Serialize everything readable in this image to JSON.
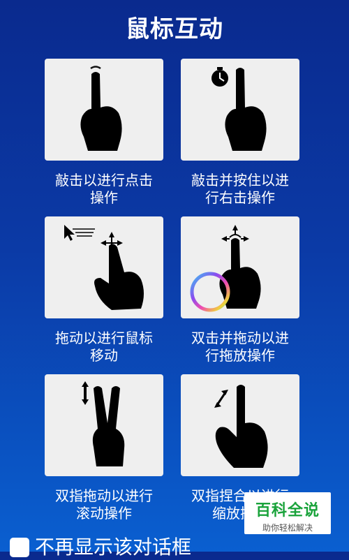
{
  "title": "鼠标互动",
  "gestures": [
    {
      "caption_line1": "敲击以进行点击",
      "caption_line2": "操作",
      "icon": "tap-hand-icon"
    },
    {
      "caption_line1": "敲击并按住以进",
      "caption_line2": "行右击操作",
      "icon": "tap-hold-hand-icon"
    },
    {
      "caption_line1": "拖动以进行鼠标",
      "caption_line2": "移动",
      "icon": "drag-hand-icon"
    },
    {
      "caption_line1": "双击并拖动以进",
      "caption_line2": "行拖放操作",
      "icon": "double-tap-drag-hand-icon"
    },
    {
      "caption_line1": "双指拖动以进行",
      "caption_line2": "滚动操作",
      "icon": "two-finger-scroll-icon"
    },
    {
      "caption_line1": "双指捏合以进行",
      "caption_line2": "缩放操作",
      "icon": "pinch-zoom-hand-icon"
    }
  ],
  "dont_show_label": "不再显示该对话框",
  "watermark": {
    "line1": "百科全说",
    "line2": "助你轻松解决"
  }
}
